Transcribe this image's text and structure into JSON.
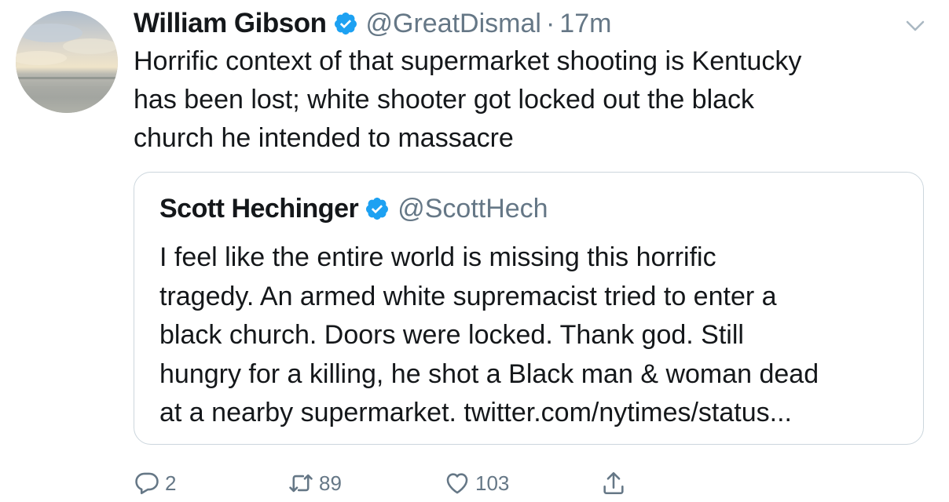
{
  "tweet": {
    "author": {
      "display_name": "William Gibson",
      "handle": "@GreatDismal",
      "verified": true
    },
    "separator": "·",
    "time": "17m",
    "text": "Horrific context of that supermarket shooting is Kentucky\nhas been lost; white shooter got locked out the black\nchurch he intended to massacre",
    "quoted": {
      "author": {
        "display_name": "Scott Hechinger",
        "handle": "@ScottHech",
        "verified": true
      },
      "text": "I feel like the entire world is missing this horrific\ntragedy. An armed white supremacist tried to enter a\nblack church. Doors were locked. Thank god. Still\nhungry for a killing, he shot a Black man & woman dead\nat a nearby supermarket. twitter.com/nytimes/status..."
    },
    "actions": {
      "reply_count": "2",
      "retweet_count": "89",
      "like_count": "103"
    }
  },
  "icons": {
    "verified": "verified-badge-icon",
    "more": "chevron-down-icon",
    "reply": "reply-icon",
    "retweet": "retweet-icon",
    "like": "heart-icon",
    "share": "share-icon"
  },
  "colors": {
    "verified_blue": "#1da1f2",
    "text_primary": "#14171a",
    "text_secondary": "#657786",
    "border": "#ccd6dd"
  }
}
